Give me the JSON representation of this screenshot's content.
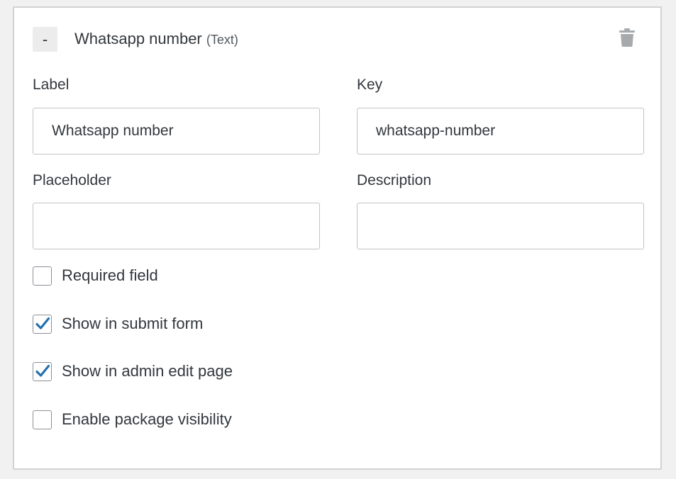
{
  "header": {
    "collapse_label": "-",
    "title": "Whatsapp number",
    "type": "(Text)",
    "delete_icon": "trash-icon"
  },
  "fields": {
    "label": {
      "label": "Label",
      "value": "Whatsapp number",
      "placeholder": ""
    },
    "key": {
      "label": "Key",
      "value": "whatsapp-number",
      "placeholder": ""
    },
    "placeholder": {
      "label": "Placeholder",
      "value": "",
      "placeholder": ""
    },
    "description": {
      "label": "Description",
      "value": "",
      "placeholder": ""
    }
  },
  "options": [
    {
      "label": "Required field",
      "checked": false
    },
    {
      "label": "Show in submit form",
      "checked": true
    },
    {
      "label": "Show in admin edit page",
      "checked": true
    },
    {
      "label": "Enable package visibility",
      "checked": false
    }
  ],
  "colors": {
    "check_accent": "#2271b1",
    "border": "#cfd2d4",
    "icon_gray": "#a7aaad"
  }
}
